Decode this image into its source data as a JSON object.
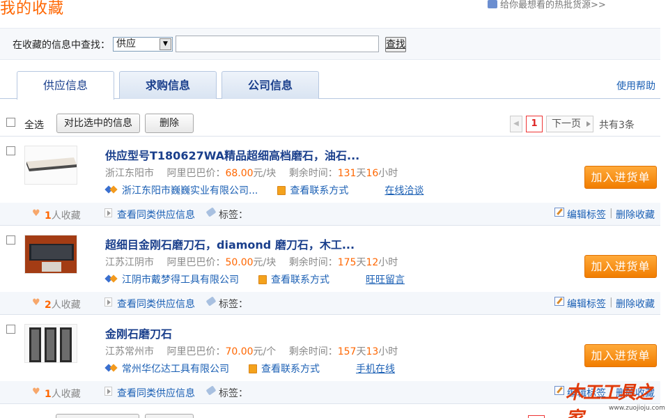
{
  "header": {
    "title": "我的收藏",
    "top_link": "给你最想看的热批货源>>"
  },
  "search": {
    "label": "在收藏的信息中查找：",
    "select_value": "供应",
    "input_value": "",
    "button_label": "查找"
  },
  "tabs": [
    {
      "label": "供应信息",
      "active": true
    },
    {
      "label": "求购信息",
      "active": false
    },
    {
      "label": "公司信息",
      "active": false
    }
  ],
  "help_link": "使用帮助",
  "toolbar": {
    "select_all": "全选",
    "compare": "对比选中的信息",
    "delete": "删除",
    "page": "1",
    "next": "下一页",
    "total": "共有3条"
  },
  "items": [
    {
      "title": "供应型号T180627WA精品超细高档磨石，油石...",
      "location": "浙江东阳市",
      "price_label": "阿里巴巴价：",
      "price": "68.00",
      "unit": "元/块",
      "remain_label": "剩余时间：",
      "days": "131",
      "day_unit": "天",
      "hours": "16",
      "hour_unit": "小时",
      "company": "浙江东阳市巍巍实业有限公司...",
      "contact": "查看联系方式",
      "chat": "在线洽谈",
      "add_button": "加入进货单",
      "fav_count": "1",
      "fav_text": "人收藏",
      "same_link": "查看同类供应信息",
      "tag_label": "标签：",
      "edit": "编辑标签",
      "sep": "|",
      "remove": "删除收藏"
    },
    {
      "title": "超细目金刚石磨刀石，diamond 磨刀石，木工...",
      "location": "江苏江阴市",
      "price_label": "阿里巴巴价：",
      "price": "50.00",
      "unit": "元/块",
      "remain_label": "剩余时间：",
      "days": "175",
      "day_unit": "天",
      "hours": "12",
      "hour_unit": "小时",
      "company": "江阴市戴梦得工具有限公司",
      "contact": "查看联系方式",
      "chat": "旺旺留言",
      "add_button": "加入进货单",
      "fav_count": "2",
      "fav_text": "人收藏",
      "same_link": "查看同类供应信息",
      "tag_label": "标签：",
      "edit": "编辑标签",
      "sep": "|",
      "remove": "删除收藏"
    },
    {
      "title": "金刚石磨刀石",
      "location": "江苏常州市",
      "price_label": "阿里巴巴价：",
      "price": "70.00",
      "unit": "元/个",
      "remain_label": "剩余时间：",
      "days": "157",
      "day_unit": "天",
      "hours": "13",
      "hour_unit": "小时",
      "company": "常州华亿达工具有限公司",
      "contact": "查看联系方式",
      "chat": "手机在线",
      "add_button": "加入进货单",
      "fav_count": "1",
      "fav_text": "人收藏",
      "same_link": "查看同类供应信息",
      "tag_label": "标签：",
      "edit": "编辑标签",
      "sep": "|",
      "remove": "删除收藏"
    }
  ],
  "watermark": {
    "main": "木工工具之家",
    "url": "www.zuojioju.com"
  },
  "colors": {
    "accent": "#ff6600",
    "link": "#1a5fb4",
    "title": "#1a3f8c"
  }
}
